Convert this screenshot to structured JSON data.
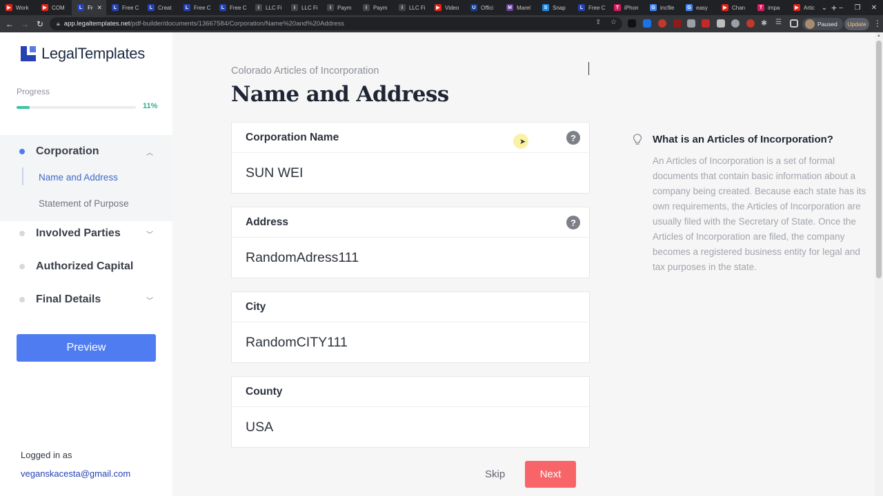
{
  "browser": {
    "tabs": [
      {
        "label": "Work",
        "color": "#e62117",
        "glyph": "▶"
      },
      {
        "label": "COM",
        "color": "#e62117",
        "glyph": "▶"
      },
      {
        "label": "Fr",
        "color": "#2541b2",
        "glyph": "L",
        "active": true
      },
      {
        "label": "Free C",
        "color": "#2541b2",
        "glyph": "L"
      },
      {
        "label": "Creat",
        "color": "#2541b2",
        "glyph": "L"
      },
      {
        "label": "Free C",
        "color": "#2541b2",
        "glyph": "L"
      },
      {
        "label": "Free C",
        "color": "#2541b2",
        "glyph": "L"
      },
      {
        "label": "LLC Fi",
        "color": "#444",
        "glyph": "i"
      },
      {
        "label": "LLC Fi",
        "color": "#444",
        "glyph": "i"
      },
      {
        "label": "Paym",
        "color": "#444",
        "glyph": "i"
      },
      {
        "label": "Paym",
        "color": "#444",
        "glyph": "i"
      },
      {
        "label": "LLC Fi",
        "color": "#444",
        "glyph": "i"
      },
      {
        "label": "Video",
        "color": "#e62117",
        "glyph": "▶"
      },
      {
        "label": "Offici",
        "color": "#1a3d8f",
        "glyph": "U"
      },
      {
        "label": "Marel",
        "color": "#6b3fa0",
        "glyph": "M"
      },
      {
        "label": "Snap",
        "color": "#1e88e5",
        "glyph": "S"
      },
      {
        "label": "Free C",
        "color": "#2541b2",
        "glyph": "L"
      },
      {
        "label": "iPhon",
        "color": "#d81b60",
        "glyph": "T"
      },
      {
        "label": "incfile",
        "color": "#4285f4",
        "glyph": "G"
      },
      {
        "label": "easy",
        "color": "#4285f4",
        "glyph": "G"
      },
      {
        "label": "Chan",
        "color": "#e62117",
        "glyph": "▶"
      },
      {
        "label": "impa",
        "color": "#d81b60",
        "glyph": "T"
      },
      {
        "label": "Artic",
        "color": "#e62117",
        "glyph": "▶"
      }
    ],
    "url_host": "app.legaltemplates.net",
    "url_path": "/pdf-builder/documents/13667584/Corporation/Name%20and%20Address",
    "profile_status": "Paused",
    "update_label": "Update"
  },
  "sidebar": {
    "brand": "LegalTemplates",
    "progress_label": "Progress",
    "progress_value": 0.11,
    "progress_text": "11%",
    "sections": [
      {
        "label": "Corporation",
        "expanded": true
      },
      {
        "label": "Involved Parties",
        "expanded": false
      },
      {
        "label": "Authorized Capital",
        "expanded": false
      },
      {
        "label": "Final Details",
        "expanded": false
      }
    ],
    "substeps": [
      "Name and Address",
      "Statement of Purpose"
    ],
    "preview_label": "Preview",
    "logged_in_label": "Logged in as",
    "email": "veganskacesta@gmail.com"
  },
  "main": {
    "kicker": "Colorado Articles of Incorporation",
    "title": "Name and Address",
    "fields": [
      {
        "label": "Corporation Name",
        "value": "SUN WEI",
        "help": true
      },
      {
        "label": "Address",
        "value": "RandomAdress111",
        "help": true
      },
      {
        "label": "City",
        "value": "RandomCITY111",
        "help": false
      },
      {
        "label": "County",
        "value": "USA",
        "help": false
      }
    ],
    "skip_label": "Skip",
    "next_label": "Next"
  },
  "tip": {
    "title": "What is an Articles of Incorporation?",
    "body": "An Articles of Incorporation is a set of formal documents that contain basic information about a company being created. Because each state has its own requirements, the Articles of Incorporation are usually filed with the Secretary of State. Once the Articles of Incorporation are filed, the company becomes a registered business entity for legal and tax purposes in the state."
  },
  "colors": {
    "accent": "#4f7df1",
    "progress": "#35c5a0",
    "next": "#f86569",
    "brand": "#2541b2"
  }
}
